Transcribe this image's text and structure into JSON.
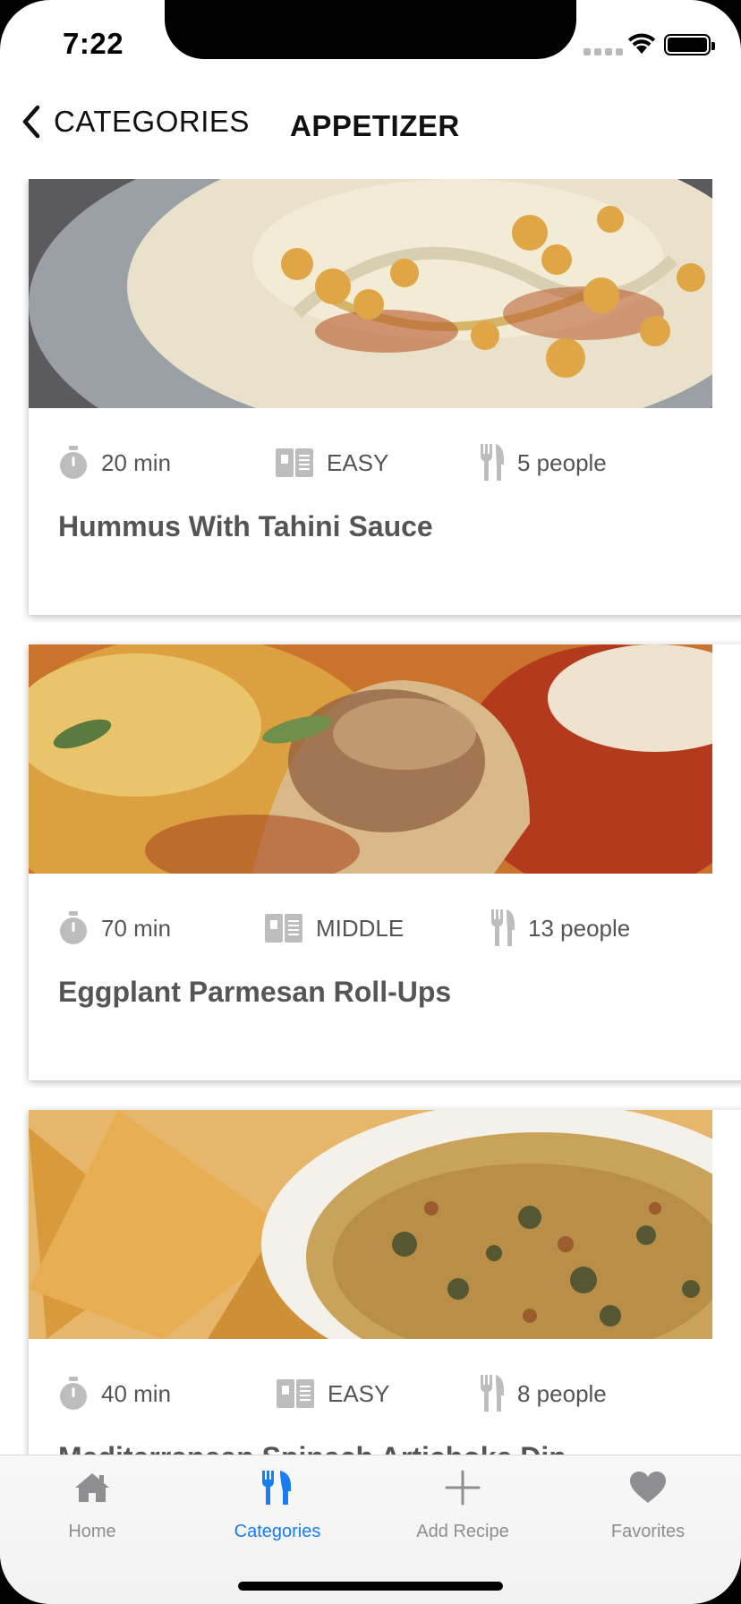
{
  "status_bar": {
    "time": "7:22"
  },
  "nav": {
    "back_label": "CATEGORIES",
    "title": "APPETIZER"
  },
  "recipes": [
    {
      "time": "20 min",
      "difficulty": "EASY",
      "servings": "5 people",
      "title": "Hummus With Tahini Sauce"
    },
    {
      "time": "70 min",
      "difficulty": "MIDDLE",
      "servings": "13 people",
      "title": "Eggplant Parmesan Roll-Ups"
    },
    {
      "time": "40 min",
      "difficulty": "EASY",
      "servings": "8 people",
      "title": "Mediterranean Spinach Artichoke Dip"
    }
  ],
  "tabs": [
    {
      "label": "Home",
      "icon": "home-icon"
    },
    {
      "label": "Categories",
      "icon": "utensils-icon"
    },
    {
      "label": "Add Recipe",
      "icon": "plus-icon"
    },
    {
      "label": "Favorites",
      "icon": "heart-icon"
    }
  ],
  "colors": {
    "accent": "#1a7cf2",
    "inactive_tab": "#8e8e93",
    "meta_text": "#555555"
  }
}
